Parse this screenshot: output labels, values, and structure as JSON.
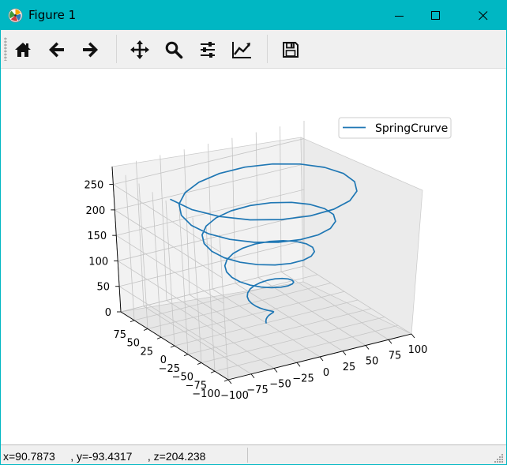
{
  "window": {
    "title": "Figure 1"
  },
  "title_bar_buttons": [
    {
      "name": "minimize-button",
      "icon": "minimize-icon"
    },
    {
      "name": "maximize-button",
      "icon": "maximize-icon"
    },
    {
      "name": "close-button",
      "icon": "close-icon"
    }
  ],
  "toolbar": {
    "tools": [
      {
        "name": "home-button",
        "icon": "home-icon"
      },
      {
        "name": "back-button",
        "icon": "arrow-left-icon"
      },
      {
        "name": "forward-button",
        "icon": "arrow-right-icon"
      },
      {
        "name": "pan-button",
        "icon": "move-icon"
      },
      {
        "name": "zoom-button",
        "icon": "magnifier-icon"
      },
      {
        "name": "subplots-button",
        "icon": "sliders-icon"
      },
      {
        "name": "edit-axes-button",
        "icon": "line-chart-icon"
      },
      {
        "name": "save-button",
        "icon": "floppy-disk-icon"
      }
    ]
  },
  "status": {
    "coordinates": "x=90.7873     , y=-93.4317     , z=204.238"
  },
  "chart_data": {
    "type": "line",
    "projection": "3d",
    "series": [
      {
        "name": "SpringCrurve",
        "color": "#1f77b4",
        "description_formula": "helix: r = t, x = t*sin(t/10*pi), y = t*cos(t/10*pi), z = 3*t for t in 0..95"
      }
    ],
    "legend_position": "upper-right",
    "axes": {
      "x": {
        "ticks": [
          "−100",
          "−75",
          "−50",
          "−25",
          "0",
          "25",
          "50",
          "75",
          "100"
        ],
        "range": [
          -100,
          100
        ]
      },
      "y": {
        "ticks": [
          "−100",
          "−75",
          "−50",
          "−25",
          "0",
          "25",
          "50",
          "75"
        ],
        "range": [
          -100,
          100
        ]
      },
      "z": {
        "ticks": [
          "0",
          "50",
          "100",
          "150",
          "200",
          "250"
        ],
        "range": [
          0,
          285
        ]
      }
    },
    "grid": true
  }
}
